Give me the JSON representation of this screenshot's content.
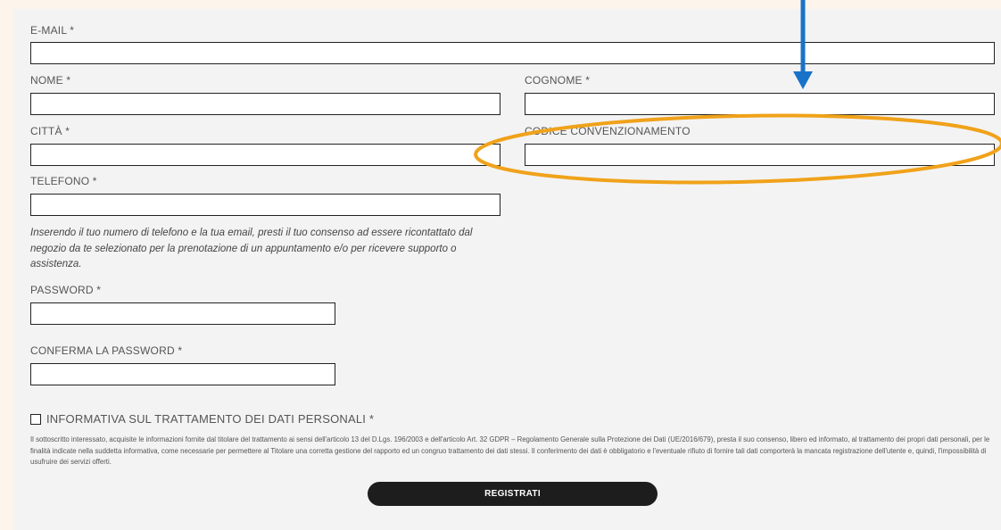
{
  "form": {
    "email_label": "E-MAIL *",
    "email_value": "",
    "nome_label": "NOME *",
    "nome_value": "",
    "cognome_label": "COGNOME *",
    "cognome_value": "",
    "citta_label": "CITTÀ *",
    "citta_value": "",
    "codice_label": "CODICE CONVENZIONAMENTO",
    "codice_value": "",
    "telefono_label": "TELEFONO *",
    "telefono_value": "",
    "consent_note": "Inserendo il tuo numero di telefono e la tua email, presti il tuo consenso ad essere ricontattato dal negozio da te selezionato per la prenotazione di un appuntamento e/o per ricevere supporto o assistenza.",
    "password_label": "PASSWORD *",
    "password_value": "",
    "confirm_password_label": "CONFERMA LA PASSWORD *",
    "confirm_password_value": "",
    "privacy_checked": false,
    "privacy_label": "INFORMATIVA SUL TRATTAMENTO DEI DATI PERSONALI *",
    "privacy_text": "Il sottoscritto interessato, acquisite le informazioni fornite dal titolare del trattamento ai sensi dell'articolo 13 del D.Lgs. 196/2003 e dell'articolo Art. 32 GDPR – Regolamento Generale sulla Protezione dei Dati (UE/2016/679), presta il suo consenso, libero ed informato, al trattamento dei propri dati personali, per le finalità indicate nella suddetta informativa, come necessarie per permettere al Titolare una corretta gestione del rapporto ed un congruo trattamento dei dati stessi. Il conferimento dei dati è obbligatorio e l'eventuale rifiuto di fornire tali dati comporterà la mancata registrazione dell'utente e, quindi, l'impossibilità di usufruire dei servizi offerti.",
    "submit_label": "REGISTRATI"
  },
  "annotations": {
    "arrow_color": "#1873c8",
    "ellipse_color": "#f0a21a"
  }
}
